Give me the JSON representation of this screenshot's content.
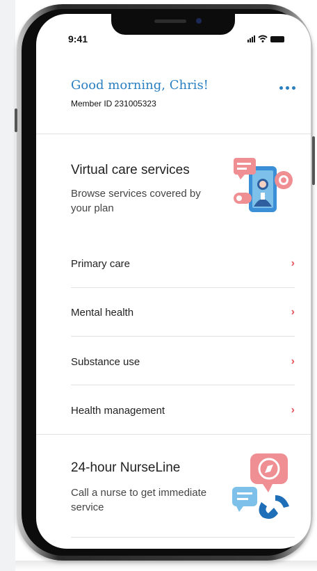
{
  "status_bar": {
    "time": "9:41"
  },
  "header": {
    "greeting": "Good morning, Chris!",
    "member_id": "Member ID  231005323"
  },
  "virtual_care": {
    "title": "Virtual care services",
    "subtitle": "Browse services covered by your plan",
    "items": [
      {
        "label": "Primary care"
      },
      {
        "label": "Mental health"
      },
      {
        "label": "Substance use"
      },
      {
        "label": "Health management"
      }
    ]
  },
  "nurseline": {
    "title": "24-hour NurseLine",
    "subtitle": "Call a nurse to get immediate service"
  },
  "icons": {
    "more": "more-horizontal-icon",
    "chevron": "chevron-right-icon",
    "virtual_care": "virtual-care-illustration",
    "nurseline": "nurseline-illustration"
  },
  "colors": {
    "accent_blue": "#2a7fc1",
    "chevron_red": "#e5565e",
    "illus_pink": "#ef8f94",
    "illus_blue": "#3a8fd6",
    "illus_light_blue": "#7dc1ea"
  }
}
